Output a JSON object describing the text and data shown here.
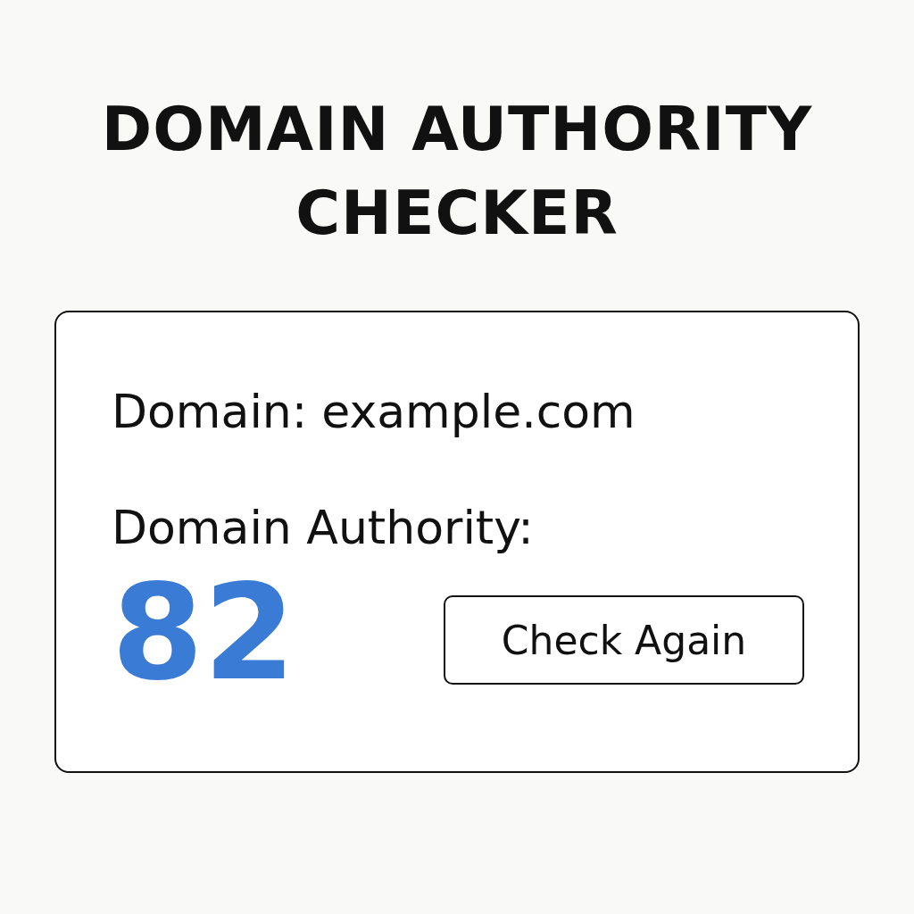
{
  "title": "DOMAIN AUTHORITY CHECKER",
  "card": {
    "domain_label": "Domain:",
    "domain_value": "example.com",
    "authority_label": "Domain Authority:",
    "score": "82",
    "button": "Check Again"
  }
}
